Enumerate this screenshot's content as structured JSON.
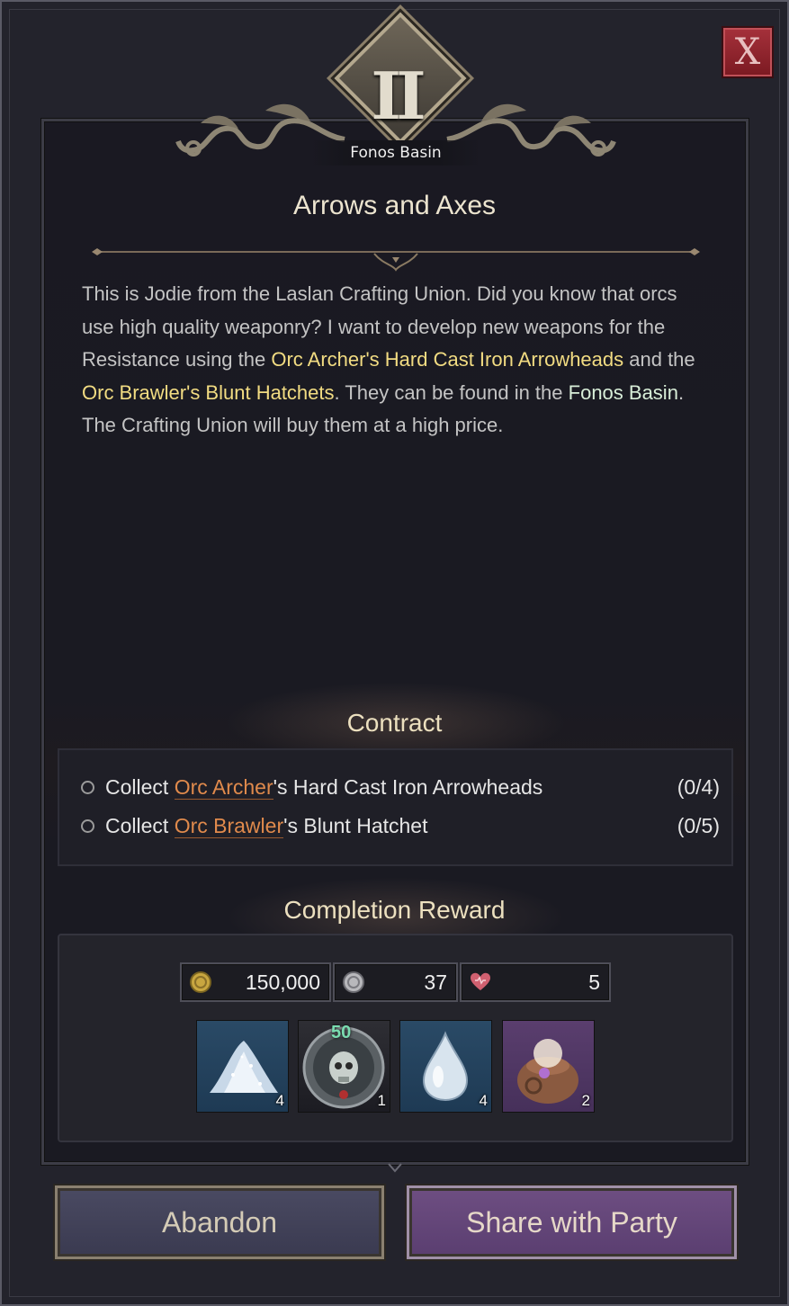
{
  "header": {
    "chapter_numeral": "II",
    "region": "Fonos Basin",
    "close_label": "X"
  },
  "quest": {
    "title": "Arrows and Axes",
    "description": {
      "part1": "This is Jodie from the Laslan Crafting Union. Did you know that orcs use high quality weaponry? I want to develop new weapons for the Resistance using the ",
      "item1": "Orc Archer's Hard Cast Iron Arrowheads",
      "part2": " and the ",
      "item2": "Orc Brawler's Blunt Hatchets",
      "part3": ". They can be found in the ",
      "location": "Fonos Basin",
      "part4": ". The Crafting Union will buy them at a high price."
    }
  },
  "contract": {
    "heading": "Contract",
    "objectives": [
      {
        "prefix": "Collect ",
        "target": "Orc Archer",
        "suffix": "'s Hard Cast Iron Arrowheads",
        "progress": "(0/4)"
      },
      {
        "prefix": "Collect ",
        "target": "Orc Brawler",
        "suffix": "'s Blunt Hatchet",
        "progress": "(0/5)"
      }
    ]
  },
  "reward": {
    "heading": "Completion Reward",
    "currencies": [
      {
        "icon": "gold-coin-icon",
        "value": "150,000"
      },
      {
        "icon": "silver-coin-icon",
        "value": "37"
      },
      {
        "icon": "heart-icon",
        "value": "5"
      }
    ],
    "items": [
      {
        "icon": "crystal-powder-icon",
        "qty": "4"
      },
      {
        "icon": "skull-medal-icon",
        "qty": "1",
        "badge": "50"
      },
      {
        "icon": "water-drop-icon",
        "qty": "4"
      },
      {
        "icon": "treasure-pouch-icon",
        "qty": "2"
      }
    ]
  },
  "buttons": {
    "abandon": "Abandon",
    "share": "Share with Party"
  },
  "colors": {
    "highlight_item": "#f2dc82",
    "highlight_location": "#d8eed8",
    "objective_link": "#e08a4c",
    "close_button": "#a4303a",
    "share_button": "#6e4e82",
    "abandon_button": "#4a4a62"
  }
}
